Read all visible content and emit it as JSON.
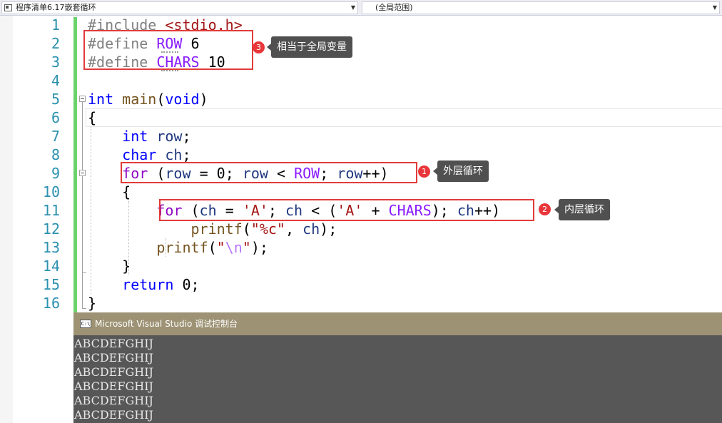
{
  "navbar": {
    "file_combo": "程序清单6.17嵌套循环",
    "scope_combo": "(全局范围)"
  },
  "line_numbers": [
    "1",
    "2",
    "3",
    "4",
    "5",
    "6",
    "7",
    "8",
    "9",
    "10",
    "11",
    "12",
    "13",
    "14",
    "15",
    "16"
  ],
  "code": {
    "l1_pp": "#include",
    "l1_str": "<stdio.h>",
    "l2_pp": "#define",
    "l2_macro": "ROW",
    "l2_val": "6",
    "l3_pp": "#define",
    "l3_macro": "CHARS",
    "l3_val": "10",
    "l5_kw": "int",
    "l5_fn": "main",
    "l5_open": "(",
    "l5_void": "void",
    "l5_close": ")",
    "l6": "{",
    "l7_kw": "int",
    "l7_id": "row",
    "l7_semi": ";",
    "l8_kw": "char",
    "l8_id": "ch",
    "l8_semi": ";",
    "l9_for": "for",
    "l9_p1": "(",
    "l9_row1": "row",
    "l9_p2": "=",
    "l9_zero": "0",
    "l9_p3": ";",
    "l9_row2": "row",
    "l9_p4": "<",
    "l9_macro": "ROW",
    "l9_p5": ";",
    "l9_row3": "row",
    "l9_p6": "++)",
    "l10": "{",
    "l11_for": "for",
    "l11_p1": "(",
    "l11_ch1": "ch",
    "l11_p2": "=",
    "l11_str1": "'A'",
    "l11_p3": ";",
    "l11_ch2": "ch",
    "l11_p4": "< (",
    "l11_str2": "'A'",
    "l11_p5": "+",
    "l11_macro": "CHARS",
    "l11_p6": ");",
    "l11_ch3": "ch",
    "l11_p7": "++)",
    "l12_fn": "printf",
    "l12_p1": "(",
    "l12_str": "\"%c\"",
    "l12_p2": ",",
    "l12_id": "ch",
    "l12_p3": ");",
    "l13_fn": "printf",
    "l13_p1": "(",
    "l13_q1": "\"",
    "l13_esc": "\\n",
    "l13_q2": "\"",
    "l13_p2": ");",
    "l14": "}",
    "l15_kw": "return",
    "l15_val": "0",
    "l15_semi": ";",
    "l16": "}"
  },
  "annotations": [
    {
      "badge": "1",
      "label": "外层循环"
    },
    {
      "badge": "2",
      "label": "内层循环"
    },
    {
      "badge": "3",
      "label": "相当于全局变量"
    }
  ],
  "console": {
    "title": "Microsoft Visual Studio 调试控制台",
    "icon_text": "C:\\",
    "output": [
      "ABCDEFGHIJ",
      "ABCDEFGHIJ",
      "ABCDEFGHIJ",
      "ABCDEFGHIJ",
      "ABCDEFGHIJ",
      "ABCDEFGHIJ"
    ]
  },
  "colors": {
    "keyword": "#0000ff",
    "control_keyword": "#8f08c4",
    "string": "#a31515",
    "macro": "#8a1bff",
    "line_number": "#2b91af",
    "annotation_red": "#e23b3b",
    "change_bar": "#6bd36b"
  }
}
